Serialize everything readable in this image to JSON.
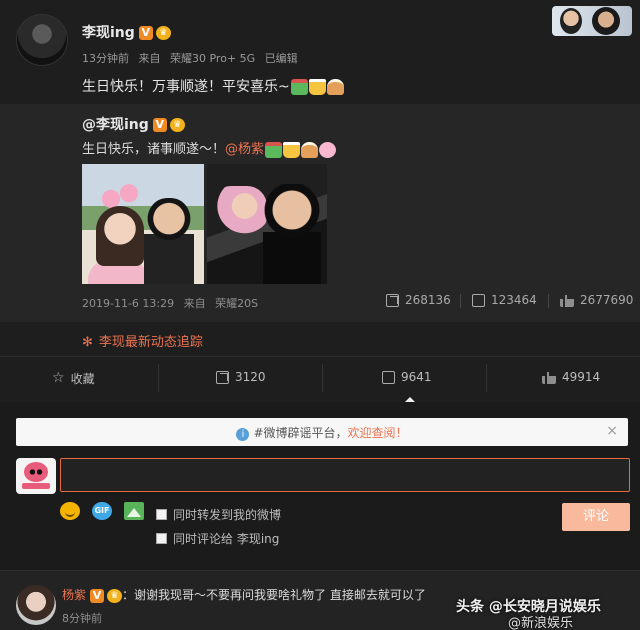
{
  "post": {
    "author": "李现ing",
    "v_badge": "V",
    "time": "13分钟前",
    "source_prefix": "来自",
    "source": "荣耀30 Pro+ 5G",
    "edited": "已编辑",
    "text": "生日快乐！万事顺遂！平安喜乐~"
  },
  "repost": {
    "author": "@李现ing",
    "text": "生日快乐，诸事顺遂～！",
    "mention": "@杨紫",
    "date": "2019-11-6 13:29",
    "source_prefix": "来自",
    "source": "荣耀20S",
    "forwards": "268136",
    "comments": "123464",
    "likes": "2677690"
  },
  "follow_link": "李现最新动态追踪",
  "actions": {
    "favorite_label": "收藏",
    "forward_count": "3120",
    "comment_count": "9641",
    "like_count": "49914"
  },
  "notice": {
    "prefix": "#微博辟谣平台，",
    "link": "欢迎查阅！",
    "close": "×"
  },
  "composer": {
    "input_value": "",
    "gif_label": "GIF",
    "repost_option": "同时转发到我的微博",
    "comment_option": "同时评论给 李现ing",
    "submit_label": "评论"
  },
  "first_comment": {
    "name": "杨紫",
    "text": "：谢谢我现哥～不要再问我要啥礼物了 直接邮去就可以了",
    "time": "8分钟前"
  },
  "watermark": {
    "main": "头条 @长安晓月说娱乐",
    "sub": "@新浪娱乐"
  },
  "colors": {
    "accent": "#eb7350",
    "badge": "#f08a24",
    "background": "#141414"
  }
}
